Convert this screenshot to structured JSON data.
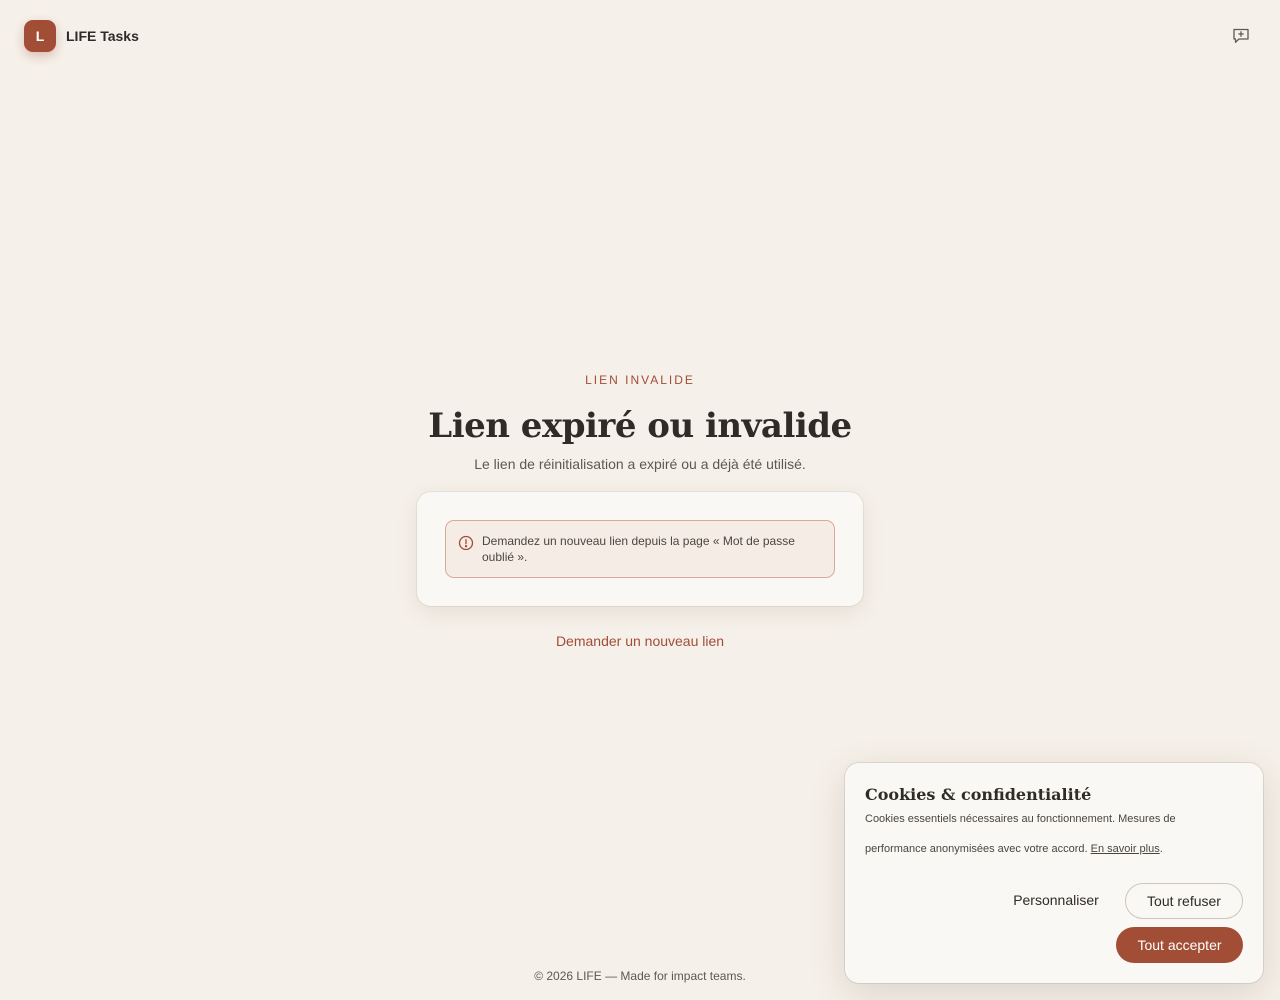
{
  "header": {
    "logo_letter": "L",
    "app_name": "LIFE Tasks",
    "feedback_icon": "message-plus-icon"
  },
  "main": {
    "eyebrow": "LIEN INVALIDE",
    "title": "Lien expiré ou invalide",
    "subtitle": "Le lien de réinitialisation a expiré ou a déjà été utilisé.",
    "alert": {
      "icon": "alert-circle-icon",
      "text": "Demandez un nouveau lien depuis la page « Mot de passe oublié »."
    },
    "new_link_label": "Demander un nouveau lien"
  },
  "footer": {
    "text": "© 2026 LIFE — Made for impact teams."
  },
  "cookie_banner": {
    "title": "Cookies & confidentialité",
    "text": "Cookies essentiels nécessaires au fonctionnement. Mesures de performance anonymisées avec votre accord.",
    "learn_more": "En savoir plus",
    "after_link": ".",
    "personalize_label": "Personnaliser",
    "refuse_label": "Tout refuser",
    "accept_label": "Tout accepter"
  },
  "colors": {
    "background": "#f5f0e9",
    "accent": "#a24d36",
    "text": "#2f2b27",
    "alert_border": "#dba99b"
  }
}
